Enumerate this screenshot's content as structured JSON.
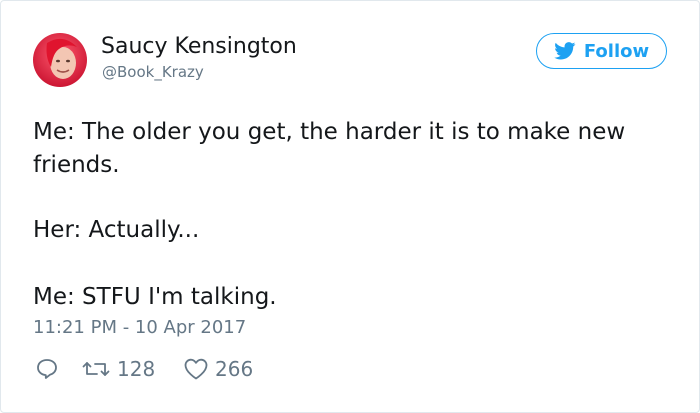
{
  "author": {
    "display_name": "Saucy Kensington",
    "handle": "@Book_Krazy",
    "avatar_icon": "avatar-photo"
  },
  "follow_button": {
    "label": "Follow",
    "icon": "twitter-bird-icon",
    "color": "#1da1f2"
  },
  "tweet": {
    "lines": [
      "Me: The older you get, the harder it is to make new",
      "friends.",
      "Her: Actually...",
      "Me: STFU I'm talking."
    ],
    "timestamp": "11:21 PM - 10 Apr 2017"
  },
  "actions": {
    "reply": {
      "icon": "reply-icon"
    },
    "retweet": {
      "icon": "retweet-icon",
      "count": "128"
    },
    "like": {
      "icon": "heart-icon",
      "count": "266"
    }
  }
}
